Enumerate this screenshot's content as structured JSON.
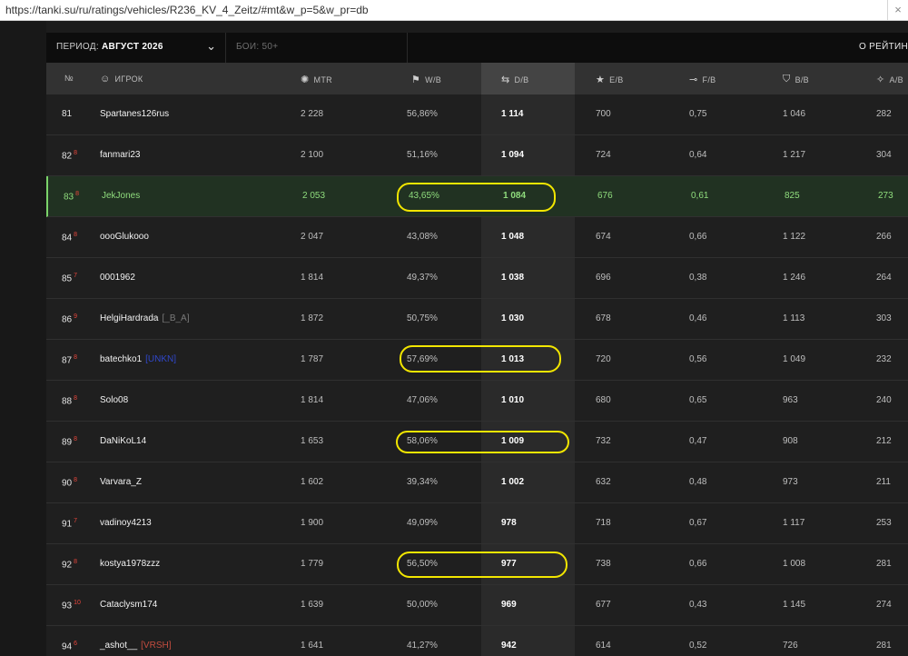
{
  "browser": {
    "url": "https://tanki.su/ru/ratings/vehicles/R236_KV_4_Zeitz/#mt&w_p=5&w_pr=db",
    "close_glyph": "×"
  },
  "filters": {
    "period_label": "ПЕРИОД:",
    "period_value": "АВГУСТ 2026",
    "battles": "БОИ: 50+",
    "about": "О РЕЙТИН"
  },
  "columns": [
    {
      "key": "rank",
      "label": "№",
      "icon": ""
    },
    {
      "key": "player",
      "label": "ИГРОК",
      "icon": "☺"
    },
    {
      "key": "mtr",
      "label": "MTR",
      "icon": "✺"
    },
    {
      "key": "wb",
      "label": "W/B",
      "icon": "⚑"
    },
    {
      "key": "db",
      "label": "D/B",
      "icon": "⇆"
    },
    {
      "key": "eb",
      "label": "E/B",
      "icon": "★"
    },
    {
      "key": "fb",
      "label": "F/B",
      "icon": "⊸"
    },
    {
      "key": "bb",
      "label": "B/B",
      "icon": "⛉"
    },
    {
      "key": "ab",
      "label": "A/B",
      "icon": "✧"
    }
  ],
  "rows": [
    {
      "rank": "81",
      "delta": "",
      "player": "Spartanes126rus",
      "clan": "",
      "clan_style": "",
      "mtr": "2 228",
      "wb": "56,86%",
      "db": "1 114",
      "eb": "700",
      "fb": "0,75",
      "bb": "1 046",
      "ab": "282",
      "highlight": false
    },
    {
      "rank": "82",
      "delta": "8",
      "player": "fanmari23",
      "clan": "",
      "clan_style": "",
      "mtr": "2 100",
      "wb": "51,16%",
      "db": "1 094",
      "eb": "724",
      "fb": "0,64",
      "bb": "1 217",
      "ab": "304",
      "highlight": false
    },
    {
      "rank": "83",
      "delta": "8",
      "player": "JekJones",
      "clan": "",
      "clan_style": "",
      "mtr": "2 053",
      "wb": "43,65%",
      "db": "1 084",
      "eb": "676",
      "fb": "0,61",
      "bb": "825",
      "ab": "273",
      "highlight": true
    },
    {
      "rank": "84",
      "delta": "8",
      "player": "oooGlukooo",
      "clan": "",
      "clan_style": "",
      "mtr": "2 047",
      "wb": "43,08%",
      "db": "1 048",
      "eb": "674",
      "fb": "0,66",
      "bb": "1 122",
      "ab": "266",
      "highlight": false
    },
    {
      "rank": "85",
      "delta": "7",
      "player": "0001962",
      "clan": "",
      "clan_style": "",
      "mtr": "1 814",
      "wb": "49,37%",
      "db": "1 038",
      "eb": "696",
      "fb": "0,38",
      "bb": "1 246",
      "ab": "264",
      "highlight": false
    },
    {
      "rank": "86",
      "delta": "9",
      "player": "HelgiHardrada",
      "clan": "[_B_A]",
      "clan_style": "gray",
      "mtr": "1 872",
      "wb": "50,75%",
      "db": "1 030",
      "eb": "678",
      "fb": "0,46",
      "bb": "1 113",
      "ab": "303",
      "highlight": false
    },
    {
      "rank": "87",
      "delta": "8",
      "player": "batechko1",
      "clan": "[UNKN]",
      "clan_style": "blue",
      "mtr": "1 787",
      "wb": "57,69%",
      "db": "1 013",
      "eb": "720",
      "fb": "0,56",
      "bb": "1 049",
      "ab": "232",
      "highlight": false
    },
    {
      "rank": "88",
      "delta": "8",
      "player": "Solo08",
      "clan": "",
      "clan_style": "",
      "mtr": "1 814",
      "wb": "47,06%",
      "db": "1 010",
      "eb": "680",
      "fb": "0,65",
      "bb": "963",
      "ab": "240",
      "highlight": false
    },
    {
      "rank": "89",
      "delta": "8",
      "player": "DaNiKoL14",
      "clan": "",
      "clan_style": "",
      "mtr": "1 653",
      "wb": "58,06%",
      "db": "1 009",
      "eb": "732",
      "fb": "0,47",
      "bb": "908",
      "ab": "212",
      "highlight": false
    },
    {
      "rank": "90",
      "delta": "8",
      "player": "Varvara_Z",
      "clan": "",
      "clan_style": "",
      "mtr": "1 602",
      "wb": "39,34%",
      "db": "1 002",
      "eb": "632",
      "fb": "0,48",
      "bb": "973",
      "ab": "211",
      "highlight": false
    },
    {
      "rank": "91",
      "delta": "7",
      "player": "vadinoy4213",
      "clan": "",
      "clan_style": "",
      "mtr": "1 900",
      "wb": "49,09%",
      "db": "978",
      "eb": "718",
      "fb": "0,67",
      "bb": "1 117",
      "ab": "253",
      "highlight": false
    },
    {
      "rank": "92",
      "delta": "8",
      "player": "kostya1978zzz",
      "clan": "",
      "clan_style": "",
      "mtr": "1 779",
      "wb": "56,50%",
      "db": "977",
      "eb": "738",
      "fb": "0,66",
      "bb": "1 008",
      "ab": "281",
      "highlight": false
    },
    {
      "rank": "93",
      "delta": "10",
      "player": "Cataclysm174",
      "clan": "",
      "clan_style": "",
      "mtr": "1 639",
      "wb": "50,00%",
      "db": "969",
      "eb": "677",
      "fb": "0,43",
      "bb": "1 145",
      "ab": "274",
      "highlight": false
    },
    {
      "rank": "94",
      "delta": "6",
      "player": "_ashot__",
      "clan": "[VRSH]",
      "clan_style": "red",
      "mtr": "1 641",
      "wb": "41,27%",
      "db": "942",
      "eb": "614",
      "fb": "0,52",
      "bb": "726",
      "ab": "281",
      "highlight": false
    }
  ],
  "annotations": {
    "color": "#f2e600",
    "circled_rows": [
      "83",
      "87",
      "89",
      "92"
    ]
  }
}
